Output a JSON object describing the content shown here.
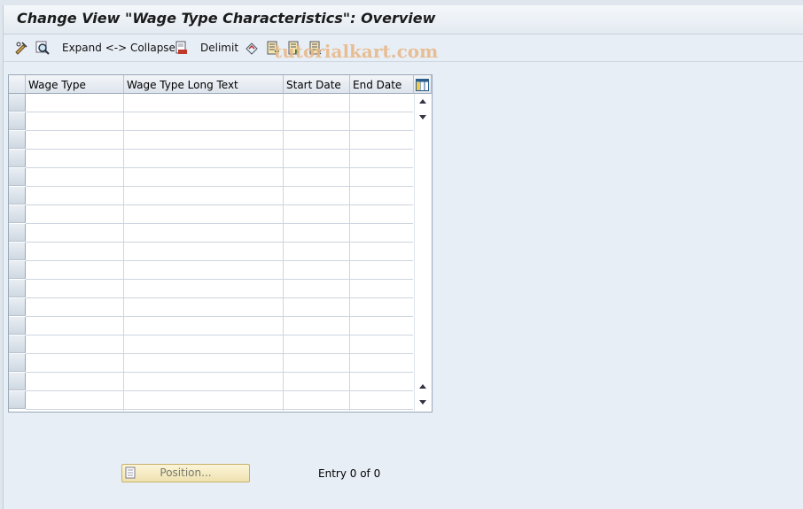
{
  "window": {
    "title": "Change View \"Wage Type Characteristics\": Overview"
  },
  "toolbar": {
    "expand_collapse_label": "Expand <-> Collapse",
    "delimit_label": "Delimit",
    "icons": [
      "display-change-icon",
      "find-icon",
      "delimit-icon",
      "navigate-icon",
      "select-all-icon",
      "select-block-icon",
      "deselect-all-icon"
    ]
  },
  "watermark": {
    "text": "tutorialkart.com"
  },
  "table": {
    "columns": [
      "Wage Type",
      "Wage Type Long Text",
      "Start Date",
      "End Date"
    ],
    "row_count": 17,
    "rows": []
  },
  "footer": {
    "position_button_label": "Position...",
    "entry_text": "Entry 0 of 0"
  },
  "colors": {
    "background": "#e8eef5",
    "table_border": "#9aa8b8",
    "button_bg": "#f5ebc3"
  }
}
